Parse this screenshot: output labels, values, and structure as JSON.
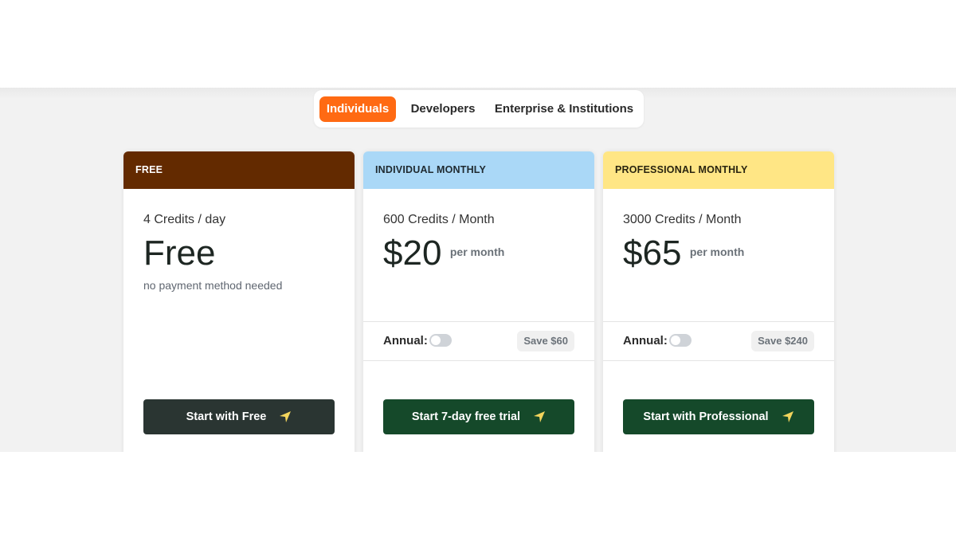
{
  "tabs": [
    {
      "label": "Individuals",
      "active": true
    },
    {
      "label": "Developers",
      "active": false
    },
    {
      "label": "Enterprise & Institutions",
      "active": false
    }
  ],
  "plans": [
    {
      "header": "FREE",
      "header_bg": "#632a00",
      "header_color": "#ffffff",
      "credits": "4 Credits / day",
      "price": "Free",
      "price_note": "no payment method needed",
      "cta": "Start with Free",
      "cta_bg": "#2a3532"
    },
    {
      "header": "INDIVIDUAL MONTHLY",
      "header_bg": "#aad8f7",
      "header_color": "#1f2a30",
      "credits": "600 Credits / Month",
      "price": "$20",
      "period": "per month",
      "annual_label": "Annual:",
      "annual_on": false,
      "save": "Save $60",
      "cta": "Start 7-day free trial",
      "cta_bg": "#15492a"
    },
    {
      "header": "PROFESSIONAL MONTHLY",
      "header_bg": "#ffe685",
      "header_color": "#2a2510",
      "credits": "3000 Credits / Month",
      "price": "$65",
      "period": "per month",
      "annual_label": "Annual:",
      "annual_on": false,
      "save": "Save $240",
      "cta": "Start with Professional",
      "cta_bg": "#15492a"
    }
  ],
  "icons": {
    "cta": "send-arrow-icon"
  },
  "colors": {
    "accent": "#ff6a13",
    "cta_icon": "#f2d45c"
  }
}
